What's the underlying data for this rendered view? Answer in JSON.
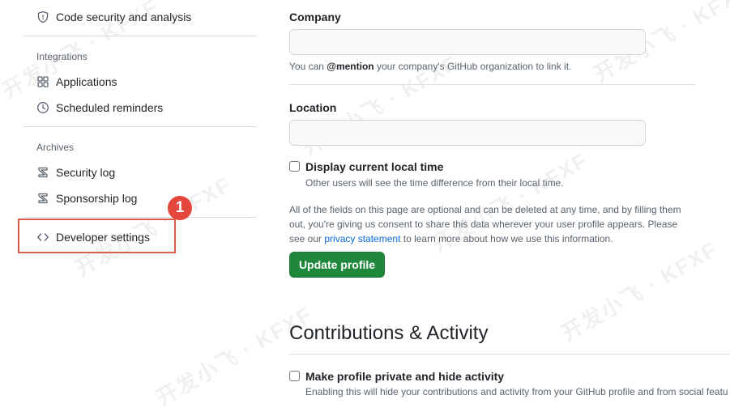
{
  "sidebar": {
    "code_security_label": "Code security and analysis",
    "integrations_title": "Integrations",
    "applications_label": "Applications",
    "scheduled_reminders_label": "Scheduled reminders",
    "archives_title": "Archives",
    "security_log_label": "Security log",
    "sponsorship_log_label": "Sponsorship log",
    "developer_settings_label": "Developer settings"
  },
  "annotation": {
    "badge_number": "1",
    "color": "#e5473d"
  },
  "profile": {
    "company_label": "Company",
    "company_value": "",
    "company_note_prefix": "You can ",
    "company_note_mention": "@mention",
    "company_note_suffix": " your company's GitHub organization to link it.",
    "location_label": "Location",
    "location_value": "",
    "local_time_label": "Display current local time",
    "local_time_note": "Other users will see the time difference from their local time.",
    "optional_text_prefix": "All of the fields on this page are optional and can be deleted at any time, and by filling them out, you're giving us consent to share this data wherever your user profile appears. Please see our ",
    "privacy_link": "privacy statement",
    "optional_text_suffix": " to learn more about how we use this information.",
    "update_button": "Update profile"
  },
  "contributions": {
    "title": "Contributions & Activity",
    "private_label": "Make profile private and hide activity",
    "private_note": "Enabling this will hide your contributions and activity from your GitHub profile and from social featu"
  },
  "watermark_text": "开发小飞 · KFXF",
  "colors": {
    "primary_button": "#1f883d",
    "link": "#0969da",
    "highlight": "#e05a4a"
  }
}
